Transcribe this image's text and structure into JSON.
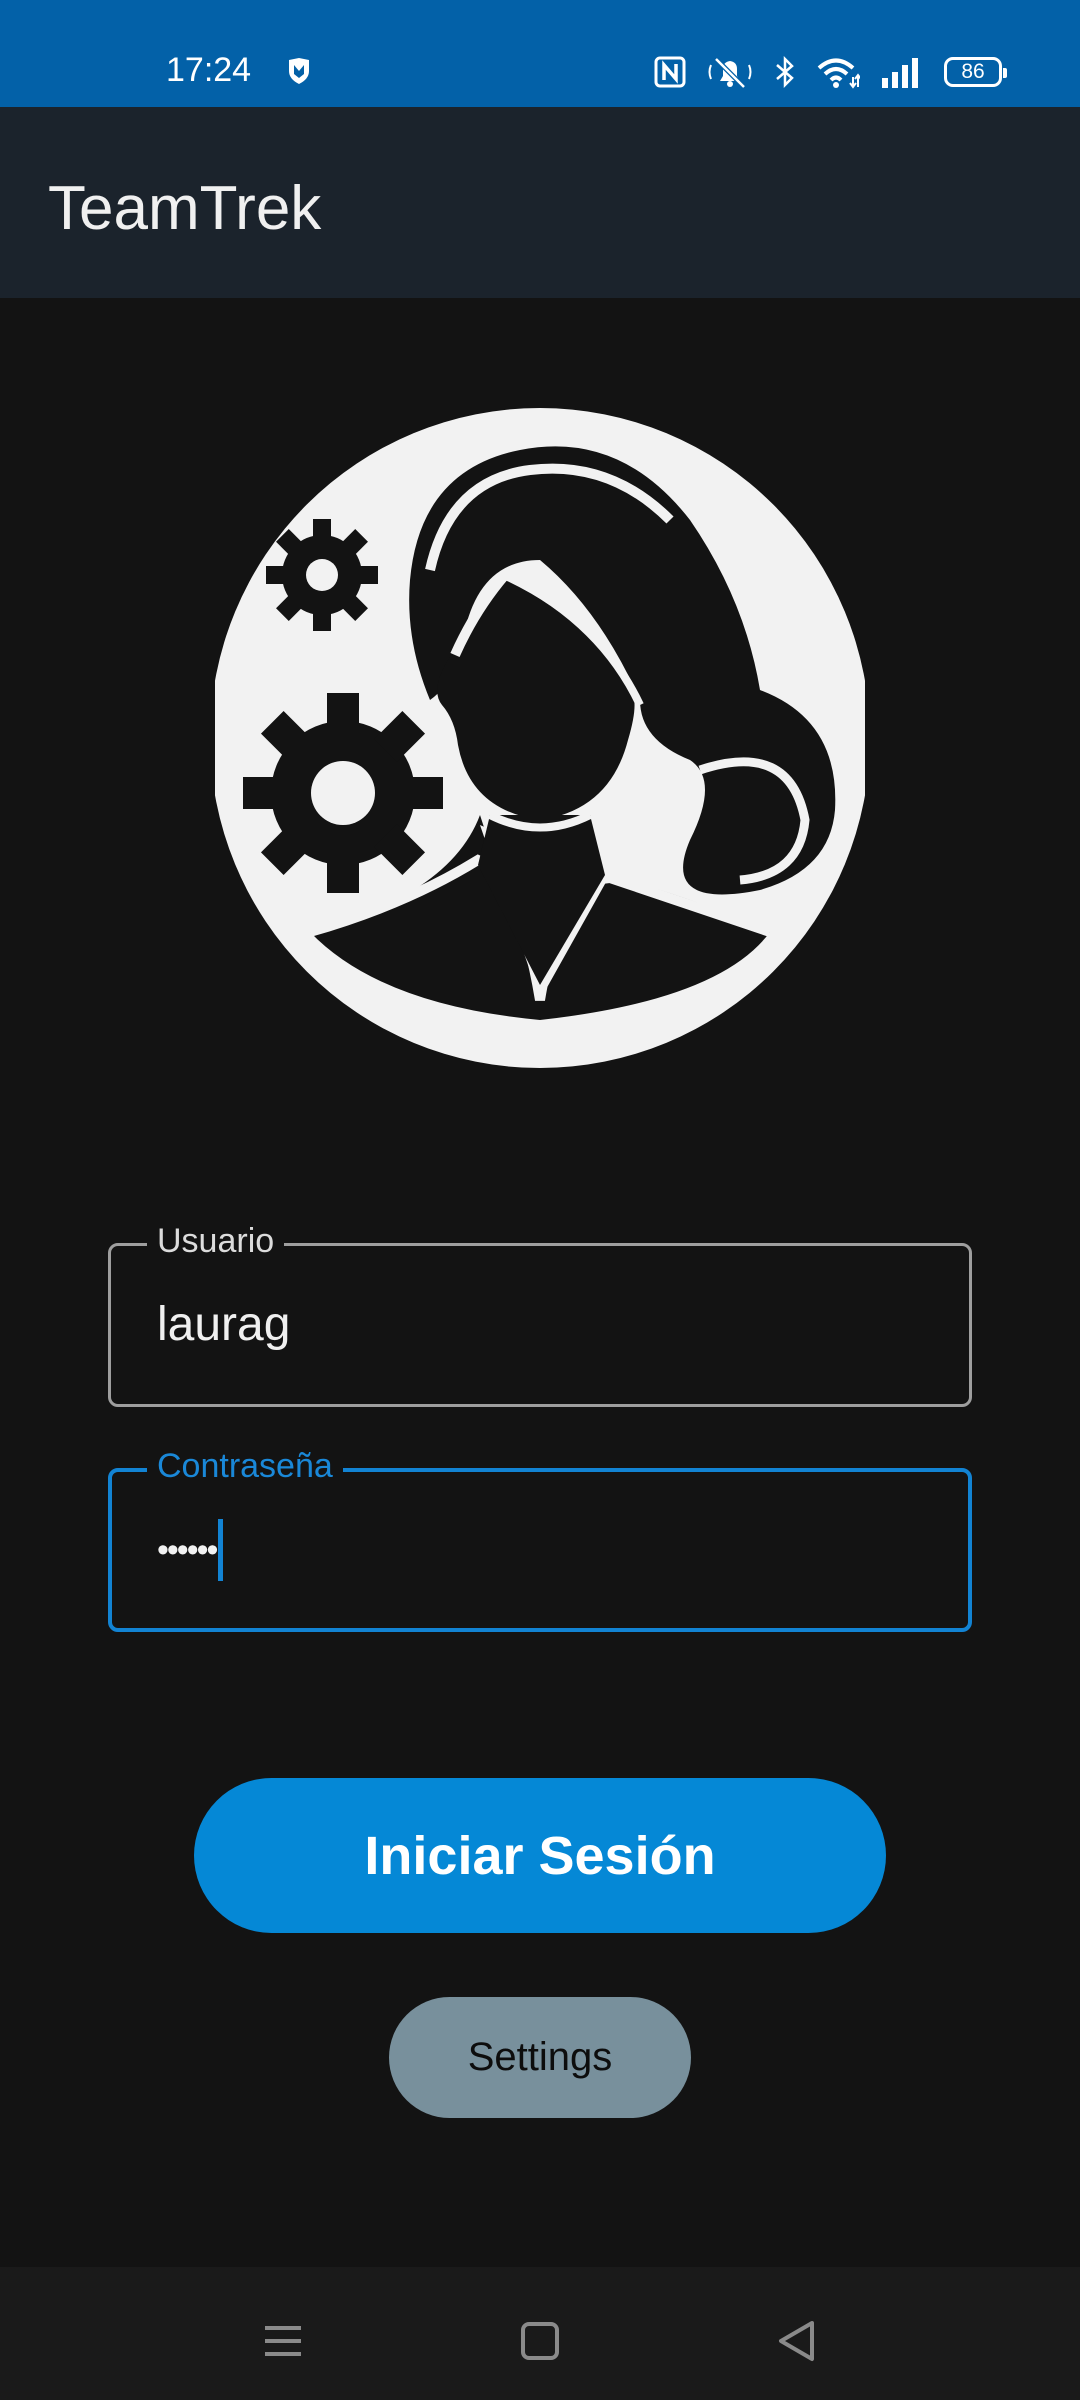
{
  "status_bar": {
    "time": "17:24",
    "battery": "86",
    "icons": [
      "shield-icon",
      "nfc-icon",
      "mute-icon",
      "bluetooth-icon",
      "wifi-icon",
      "signal-icon",
      "battery-icon"
    ]
  },
  "app_bar": {
    "title": "TeamTrek"
  },
  "login": {
    "username_label": "Usuario",
    "username_value": "laurag",
    "password_label": "Contraseña",
    "password_value": "••••••",
    "login_button": "Iniciar Sesión",
    "settings_button": "Settings"
  },
  "nav_bar": {
    "buttons": [
      "menu-icon",
      "home-icon",
      "back-icon"
    ]
  },
  "colors": {
    "status_bar": "#0361a8",
    "app_bar": "#1b232c",
    "background": "#131313",
    "accent": "#0588d6",
    "settings_button": "#78909c",
    "avatar": "#f2f2f2"
  }
}
